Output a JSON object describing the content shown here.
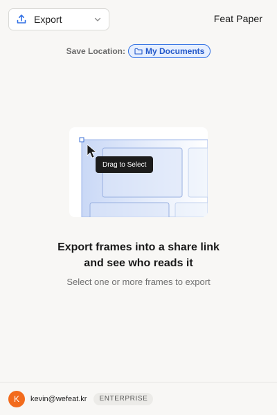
{
  "header": {
    "export_label": "Export",
    "brand": "Feat Paper"
  },
  "save_location": {
    "label": "Save Location:",
    "folder": "My Documents"
  },
  "illustration": {
    "tooltip": "Drag to Select"
  },
  "empty_state": {
    "headline_line1": "Export frames into a share link",
    "headline_line2": "and see who reads it",
    "subtext": "Select one or more frames to export"
  },
  "footer": {
    "avatar_initial": "K",
    "email": "kevin@wefeat.kr",
    "plan": "ENTERPRISE"
  },
  "colors": {
    "accent": "#2f6fe4",
    "avatar": "#f26b1d",
    "background": "#f8f7f5"
  },
  "icons": [
    "upload-icon",
    "chevron-down-icon",
    "folder-icon",
    "cursor-arrow-icon"
  ]
}
